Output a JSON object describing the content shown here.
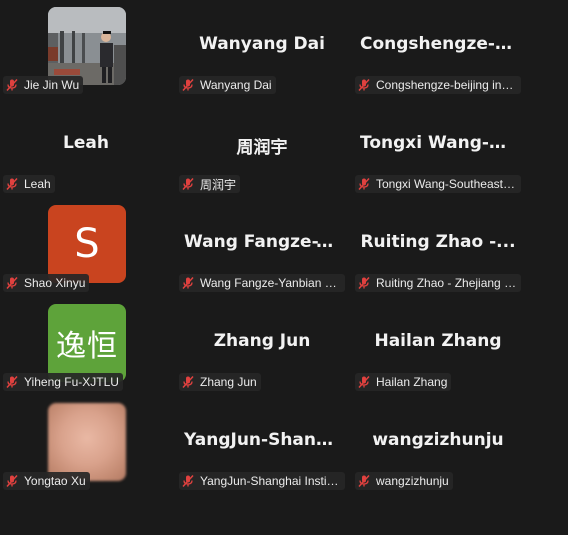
{
  "participants": [
    {
      "name": "Jie Jin Wu",
      "tile_text": "",
      "avatar": "photo"
    },
    {
      "name": "Wanyang Dai",
      "tile_text": "Wanyang Dai",
      "avatar": "none"
    },
    {
      "name": "Congshengze-beijing inst...",
      "tile_text": "Congshengze-b...",
      "avatar": "none"
    },
    {
      "name": "Leah",
      "tile_text": "Leah",
      "avatar": "none"
    },
    {
      "name": "周润宇",
      "tile_text": "周润宇",
      "avatar": "none"
    },
    {
      "name": "Tongxi Wang-Southeast U...",
      "tile_text": "Tongxi Wang-S...",
      "avatar": "none"
    },
    {
      "name": "Shao Xinyu",
      "tile_text": "S",
      "avatar": "letter"
    },
    {
      "name": "Wang Fangze-Yanbian Un...",
      "tile_text": "Wang Fangze-Y...",
      "avatar": "none"
    },
    {
      "name": "Ruiting Zhao - Zhejiang U...",
      "tile_text": "Ruiting Zhao -...",
      "avatar": "none"
    },
    {
      "name": "Yiheng Fu-XJTLU",
      "tile_text": "逸恒",
      "avatar": "chinese"
    },
    {
      "name": "Zhang Jun",
      "tile_text": "Zhang Jun",
      "avatar": "none"
    },
    {
      "name": "Hailan Zhang",
      "tile_text": "Hailan Zhang",
      "avatar": "none"
    },
    {
      "name": "Yongtao Xu",
      "tile_text": "",
      "avatar": "blurred-photo"
    },
    {
      "name": "YangJun-Shanghai Institu...",
      "tile_text": "YangJun-Shang...",
      "avatar": "none"
    },
    {
      "name": "wangzizhunju",
      "tile_text": "wangzizhunju",
      "avatar": "none"
    }
  ],
  "colors": {
    "background": "#1a1a1a",
    "muted_mic": "#e0413f",
    "avatar_orange": "#c9441f",
    "avatar_green": "#5ea33a"
  },
  "icons": {
    "mic_status": "muted-microphone-icon"
  }
}
